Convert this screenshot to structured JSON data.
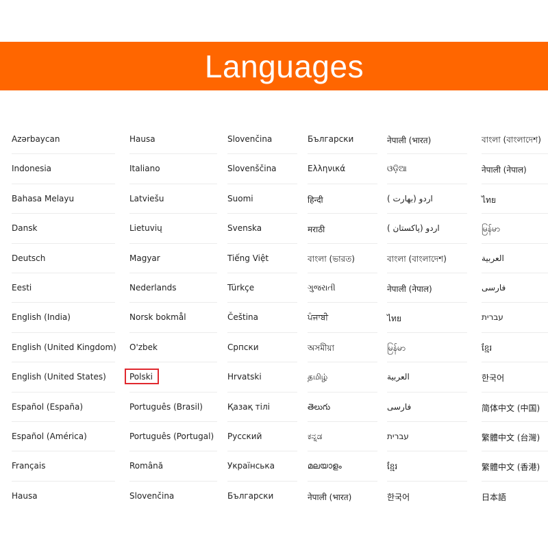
{
  "header": {
    "title": "Languages",
    "background_color": "#ff6600",
    "text_color": "#ffffff"
  },
  "languages": {
    "columns": [
      [
        "Azərbaycan",
        "Indonesia",
        "Bahasa Melayu",
        "Dansk",
        "Deutsch",
        "Eesti",
        "English (India)",
        "English (United Kingdom)",
        "English (United States)",
        "Español (España)",
        "Español (América)",
        "Français",
        "Hausa"
      ],
      [
        "Hausa",
        "Italiano",
        "Latviešu",
        "Lietuvių",
        "Magyar",
        "Nederlands",
        "Norsk bokmål",
        "O'zbek",
        "Polski",
        "Português (Brasil)",
        "Português (Portugal)",
        "Română",
        "Slovenčina"
      ],
      [
        "Slovenčina",
        "Slovenščina",
        "Suomi",
        "Svenska",
        "Tiếng Việt",
        "Türkçe",
        "Čeština",
        "Српски",
        "Hrvatski",
        "Қазақ тілі",
        "Русский",
        "Українська",
        "Български"
      ],
      [
        "Български",
        "Ελληνικά",
        "हिन्दी",
        "मराठी",
        "বাংলা (ভারত)",
        "ગુજરાતી",
        "ਪੰਜਾਬੀ",
        "অসমীয়া",
        "தமிழ்",
        "తెలుగు",
        "ಕನ್ನಡ",
        "മലയാളം",
        "नेपाली (भारत)"
      ],
      [
        "नेपाली (भारत)",
        "ଓଡ଼ିଆ",
        "اردو (بھارت )",
        "اردو (پاکستان )",
        "বাংলা (বাংলাদেশ)",
        "नेपाली (नेपाल)",
        "ไทย",
        "မြန်မာ",
        "العربية",
        "فارسی",
        "עברית",
        "ខ្មែរ",
        "한국어"
      ],
      [
        "বাংলা (বাংলাদেশ)",
        "नेपाली (नेपाल)",
        "ไทย",
        "မြန်မာ",
        "العربية",
        "فارسی",
        "עברית",
        "ខ្មែរ",
        "한국어",
        "简体中文 (中国)",
        "繁體中文 (台灣)",
        "繁體中文 (香港)",
        "日本語"
      ]
    ],
    "selected": "Polski",
    "highlight_color": "#e0282e"
  }
}
